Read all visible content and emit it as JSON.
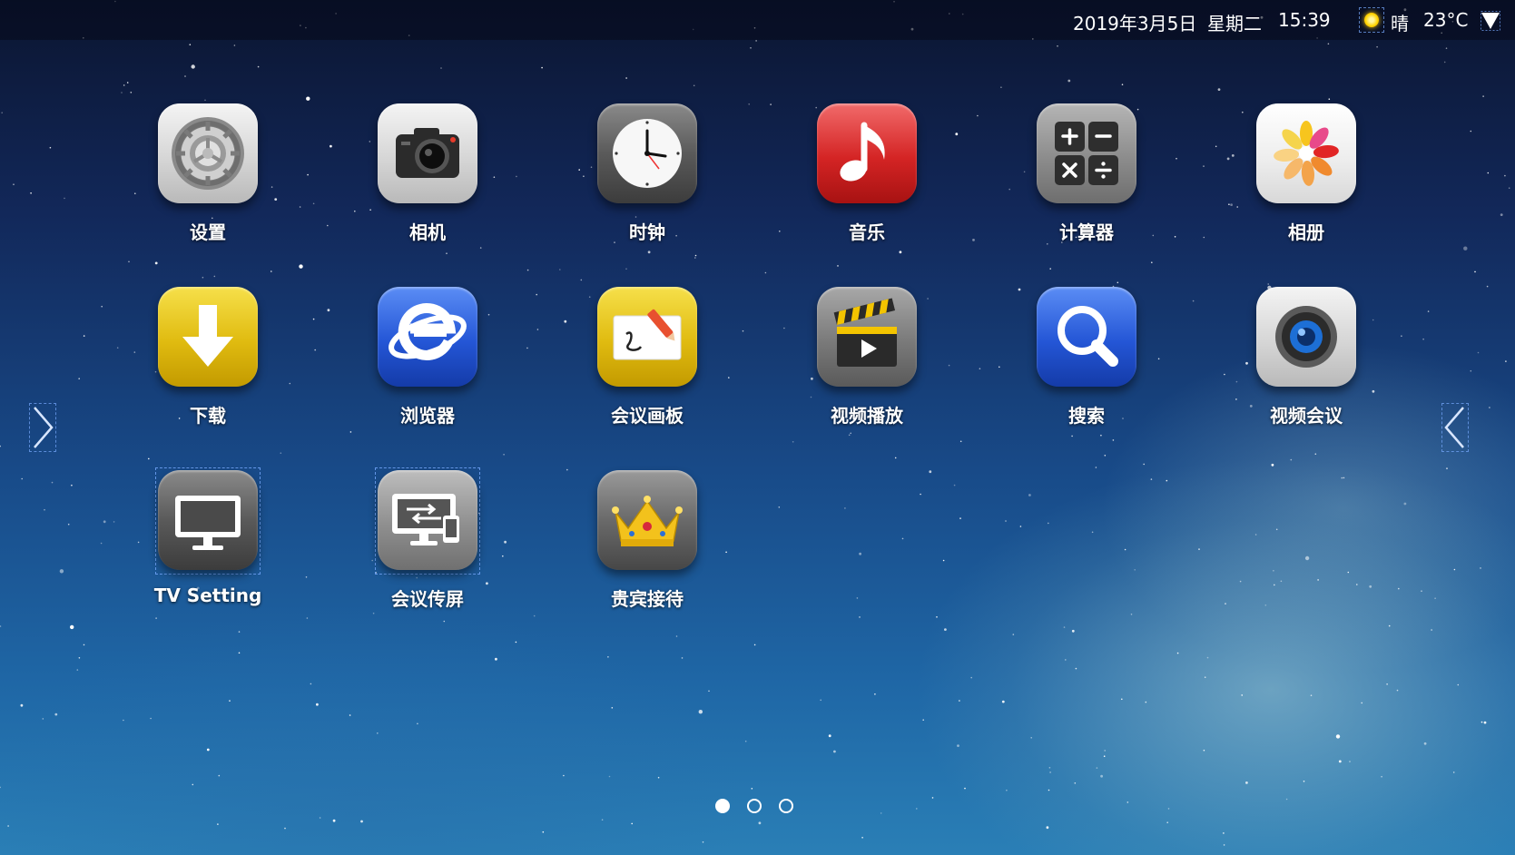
{
  "status_bar": {
    "date": "2019年3月5日",
    "weekday": "星期二",
    "time": "15:39",
    "weather_icon": "sun-icon",
    "weather": "晴",
    "temperature": "23°C",
    "network_icon": "wifi-icon"
  },
  "apps": [
    {
      "label": "设置",
      "icon": "settings-gear-icon"
    },
    {
      "label": "相机",
      "icon": "camera-icon"
    },
    {
      "label": "时钟",
      "icon": "clock-icon"
    },
    {
      "label": "音乐",
      "icon": "music-note-icon"
    },
    {
      "label": "计算器",
      "icon": "calculator-icon"
    },
    {
      "label": "相册",
      "icon": "photos-flower-icon"
    },
    {
      "label": "下载",
      "icon": "download-arrow-icon"
    },
    {
      "label": "浏览器",
      "icon": "browser-e-icon"
    },
    {
      "label": "会议画板",
      "icon": "whiteboard-pen-icon"
    },
    {
      "label": "视频播放",
      "icon": "clapperboard-play-icon"
    },
    {
      "label": "搜索",
      "icon": "magnifier-icon"
    },
    {
      "label": "视频会议",
      "icon": "webcam-lens-icon"
    },
    {
      "label": "TV Setting",
      "icon": "monitor-icon",
      "selected": true
    },
    {
      "label": "会议传屏",
      "icon": "screen-share-icon",
      "selected": true
    },
    {
      "label": "贵宾接待",
      "icon": "crown-icon"
    }
  ],
  "navigation": {
    "prev_icon": "chevron-right-icon",
    "next_icon": "chevron-left-icon"
  },
  "pagination": {
    "pages": 3,
    "current": 1
  },
  "colors": {
    "status_text": "#ffffff",
    "music_red": "#d42424",
    "download_yellow": "#e0bb10",
    "search_blue": "#2456d6"
  }
}
